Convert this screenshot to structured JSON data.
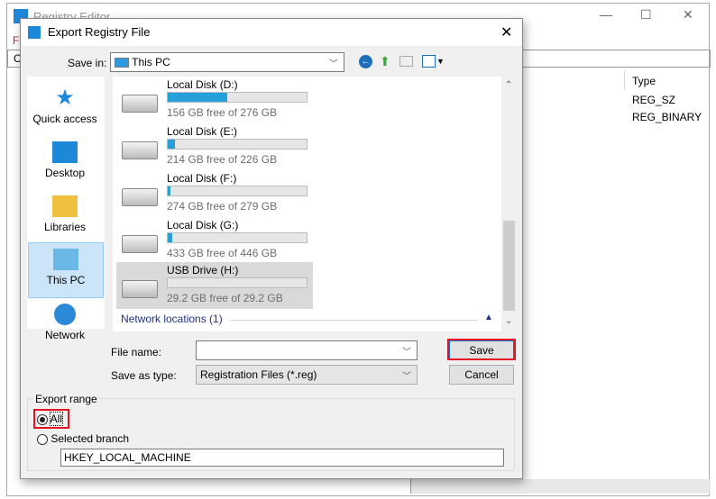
{
  "background_window": {
    "title": "Registry Editor",
    "menu_letter": "F",
    "address_letter": "C",
    "column_type": "Type",
    "rows": [
      "REG_SZ",
      "REG_BINARY"
    ]
  },
  "dialog": {
    "title": "Export Registry File",
    "save_in_label": "Save in:",
    "save_in_value": "This PC",
    "places": [
      {
        "label": "Quick access",
        "icon": "star-icon"
      },
      {
        "label": "Desktop",
        "icon": "desktop-icon"
      },
      {
        "label": "Libraries",
        "icon": "libraries-icon"
      },
      {
        "label": "This PC",
        "icon": "computer-icon",
        "selected": true
      },
      {
        "label": "Network",
        "icon": "network-icon"
      }
    ],
    "drives": [
      {
        "name": "Local Disk (D:)",
        "free": "156 GB free of 276 GB",
        "used_percent": 43
      },
      {
        "name": "Local Disk (E:)",
        "free": "214 GB free of 226 GB",
        "used_percent": 5
      },
      {
        "name": "Local Disk (F:)",
        "free": "274 GB free of 279 GB",
        "used_percent": 2
      },
      {
        "name": "Local Disk (G:)",
        "free": "433 GB free of 446 GB",
        "used_percent": 3
      },
      {
        "name": "USB Drive (H:)",
        "free": "29.2 GB free of 29.2 GB",
        "used_percent": 0,
        "selected": true
      }
    ],
    "network_group": "Network locations (1)",
    "file_name_label": "File name:",
    "file_name_value": "",
    "save_type_label": "Save as type:",
    "save_type_value": "Registration Files (*.reg)",
    "save_button": "Save",
    "cancel_button": "Cancel",
    "export_range_label": "Export range",
    "all_label": "All",
    "selected_branch_label": "Selected branch",
    "branch_value": "HKEY_LOCAL_MACHINE",
    "highlight_color": "#e81123",
    "accent_color": "#26a0da"
  }
}
